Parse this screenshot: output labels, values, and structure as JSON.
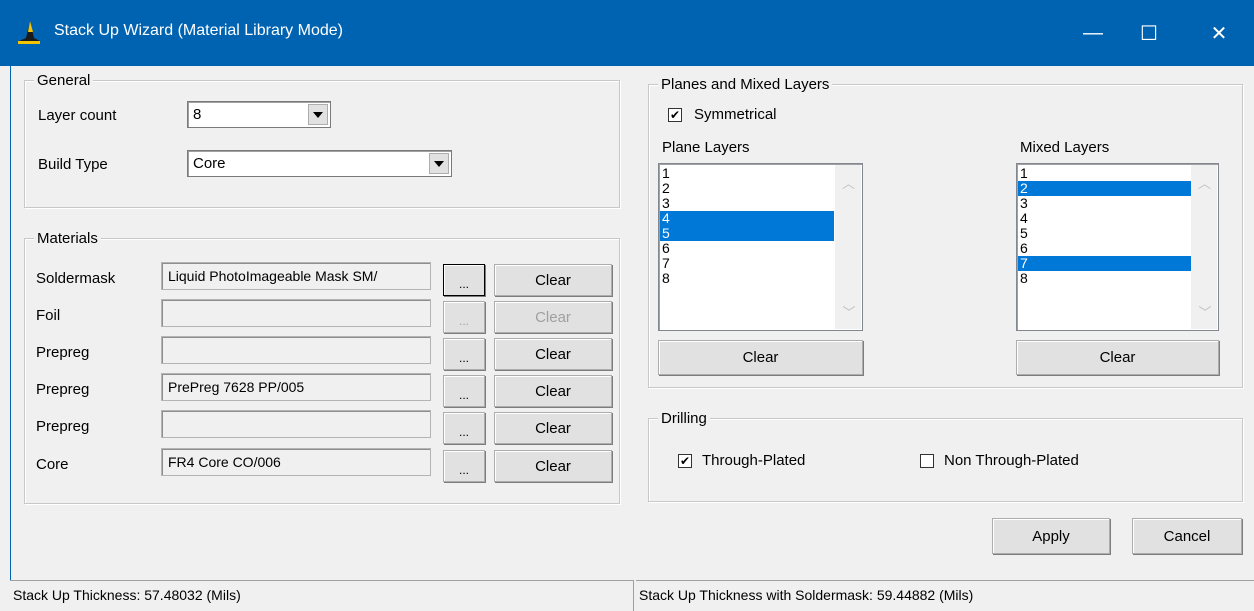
{
  "window": {
    "title": "Stack Up Wizard (Material Library Mode)",
    "controls": {
      "minimize": "—",
      "maximize": "☐",
      "close": "✕"
    }
  },
  "general": {
    "title": "General",
    "layer_count_label": "Layer count",
    "layer_count_value": "8",
    "build_type_label": "Build Type",
    "build_type_value": "Core"
  },
  "materials": {
    "title": "Materials",
    "browse_label": "...",
    "clear_label": "Clear",
    "rows": [
      {
        "label": "Soldermask",
        "value": "Liquid PhotoImageable Mask  SM/",
        "enabled": true
      },
      {
        "label": "Foil",
        "value": "",
        "enabled": false
      },
      {
        "label": "Prepreg",
        "value": "",
        "enabled": true
      },
      {
        "label": "Prepreg",
        "value": "PrePreg 7628  PP/005",
        "enabled": true
      },
      {
        "label": "Prepreg",
        "value": "",
        "enabled": true
      },
      {
        "label": "Core",
        "value": "FR4 Core  CO/006",
        "enabled": true
      }
    ]
  },
  "planes": {
    "title": "Planes and Mixed Layers",
    "symmetrical_label": "Symmetrical",
    "symmetrical_checked": true,
    "plane_layers_label": "Plane Layers",
    "mixed_layers_label": "Mixed Layers",
    "plane_items": [
      "1",
      "2",
      "3",
      "4",
      "5",
      "6",
      "7",
      "8"
    ],
    "plane_selected": [
      "4",
      "5"
    ],
    "mixed_items": [
      "1",
      "2",
      "3",
      "4",
      "5",
      "6",
      "7",
      "8"
    ],
    "mixed_selected": [
      "2",
      "7"
    ],
    "clear_plane_label": "Clear",
    "clear_mixed_label": "Clear"
  },
  "drilling": {
    "title": "Drilling",
    "through_plated_label": "Through-Plated",
    "through_plated_checked": true,
    "non_through_plated_label": "Non Through-Plated",
    "non_through_plated_checked": false
  },
  "buttons": {
    "apply": "Apply",
    "cancel": "Cancel"
  },
  "status": {
    "thickness": "Stack Up Thickness: 57.48032 (Mils)",
    "thickness_with_mask": "Stack Up Thickness with Soldermask: 59.44882 (Mils)"
  },
  "colors": {
    "titlebar": "#0063b1",
    "selection": "#0078d7",
    "face": "#f0f0f0"
  },
  "icons": {
    "app": "wizard-hat-icon",
    "combo_arrow": "dropdown-arrow-icon",
    "scroll_up": "chevron-up-icon",
    "scroll_down": "chevron-down-icon"
  }
}
